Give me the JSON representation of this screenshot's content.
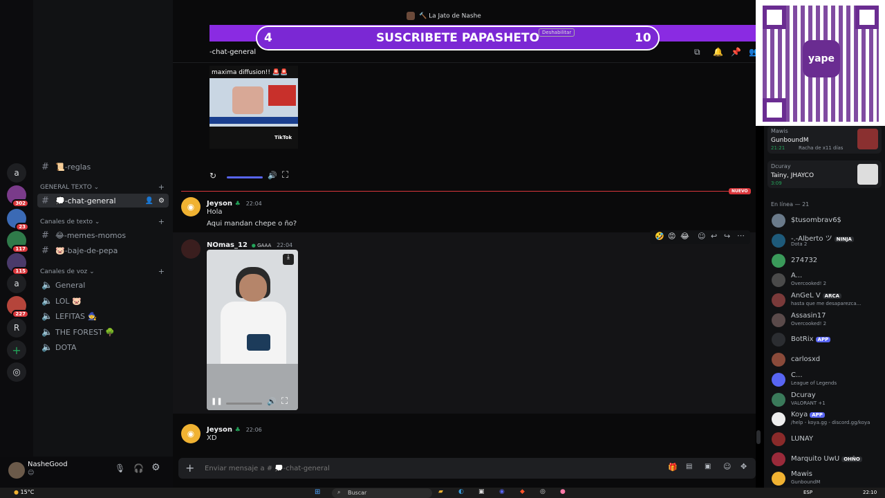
{
  "window": {
    "title": "La Jato de Nashe"
  },
  "banner": {
    "left_count": "4",
    "text": "SUSCRIBETE PAPASHETO",
    "right_count": "10",
    "hidden_button": "Deshabilitar"
  },
  "channel_header": {
    "name": "-chat-general"
  },
  "servers": [
    {
      "label": "a"
    },
    {
      "label": "",
      "badge": "302"
    },
    {
      "label": "",
      "badge": "23"
    },
    {
      "label": "",
      "badge": "117"
    },
    {
      "label": "",
      "badge": "115"
    },
    {
      "label": "a"
    },
    {
      "label": "",
      "badge": "227"
    },
    {
      "label": "R"
    }
  ],
  "sidebar": {
    "top_channel": "📜-reglas",
    "cat_general": "GENERAL TEXTO",
    "active_channel": "💭-chat-general",
    "cat_texto": "Canales de texto",
    "text_channels": [
      "😂-memes-momos",
      "🐷-baje-de-pepa"
    ],
    "cat_voz": "Canales de voz",
    "voice_channels": [
      "General",
      "LOL 🐷",
      "LEFITAS 🧙",
      "THE FOREST 🌳",
      "DOTA"
    ]
  },
  "user": {
    "name": "NasheGood"
  },
  "messages": {
    "embed_title": "maxima diffusion!! 🚨🚨",
    "embed_source": "TikTok",
    "new_label": "NUEVO",
    "m1": {
      "author": "Jeyson",
      "time": "22:04",
      "lines": [
        "Hola",
        "Aqui mandan chepe o ño?"
      ]
    },
    "m2": {
      "author": "NOmas_12",
      "tag": "GAAA",
      "time": "22:04"
    },
    "m3": {
      "author": "Jeyson",
      "time": "22:06",
      "lines": [
        "XD"
      ]
    }
  },
  "input": {
    "placeholder": "Enviar mensaje a # 💭-chat-general"
  },
  "activity_cards": [
    {
      "user": "Mawis",
      "game": "GunboundM",
      "time": "21:21",
      "extra": "Racha de x11 días"
    },
    {
      "user": "Dcuray",
      "game": "Tainy, JHAYCO",
      "time": "3:09"
    }
  ],
  "members": {
    "header": "En línea — 21",
    "list": [
      {
        "name": "$tusombrav6$",
        "status": ""
      },
      {
        "name": "-.-Alberto ツ",
        "tag": "NINJA",
        "status": "Dota 2"
      },
      {
        "name": "274732",
        "status": ""
      },
      {
        "name": "A...",
        "status": "Overcooked! 2"
      },
      {
        "name": "AnGeL V",
        "tag": "ARCA",
        "status": "hasta que me desaparezca..."
      },
      {
        "name": "Assasin17",
        "status": "Overcooked! 2"
      },
      {
        "name": "BotRix",
        "tag": "APP",
        "status": ""
      },
      {
        "name": "carlosxd",
        "status": ""
      },
      {
        "name": "C...",
        "status": "League of Legends"
      },
      {
        "name": "Dcuray",
        "status": "VALORANT +1"
      },
      {
        "name": "Koya",
        "tag": "APP",
        "status": "/help - koya.gg - discord.gg/koya"
      },
      {
        "name": "LUNAY",
        "status": ""
      },
      {
        "name": "Marquito UwU",
        "tag": "OHÑO",
        "status": ""
      },
      {
        "name": "Mawis",
        "status": "GunboundM"
      }
    ]
  },
  "taskbar": {
    "weather": "15°C",
    "search": "Buscar",
    "lang": "ESP",
    "time": "22:10"
  },
  "qr": {
    "brand": "yape"
  },
  "colors": {
    "accent": "#5865f2",
    "banner": "#8a2be2",
    "new": "#da373c",
    "online": "#23a55a"
  }
}
